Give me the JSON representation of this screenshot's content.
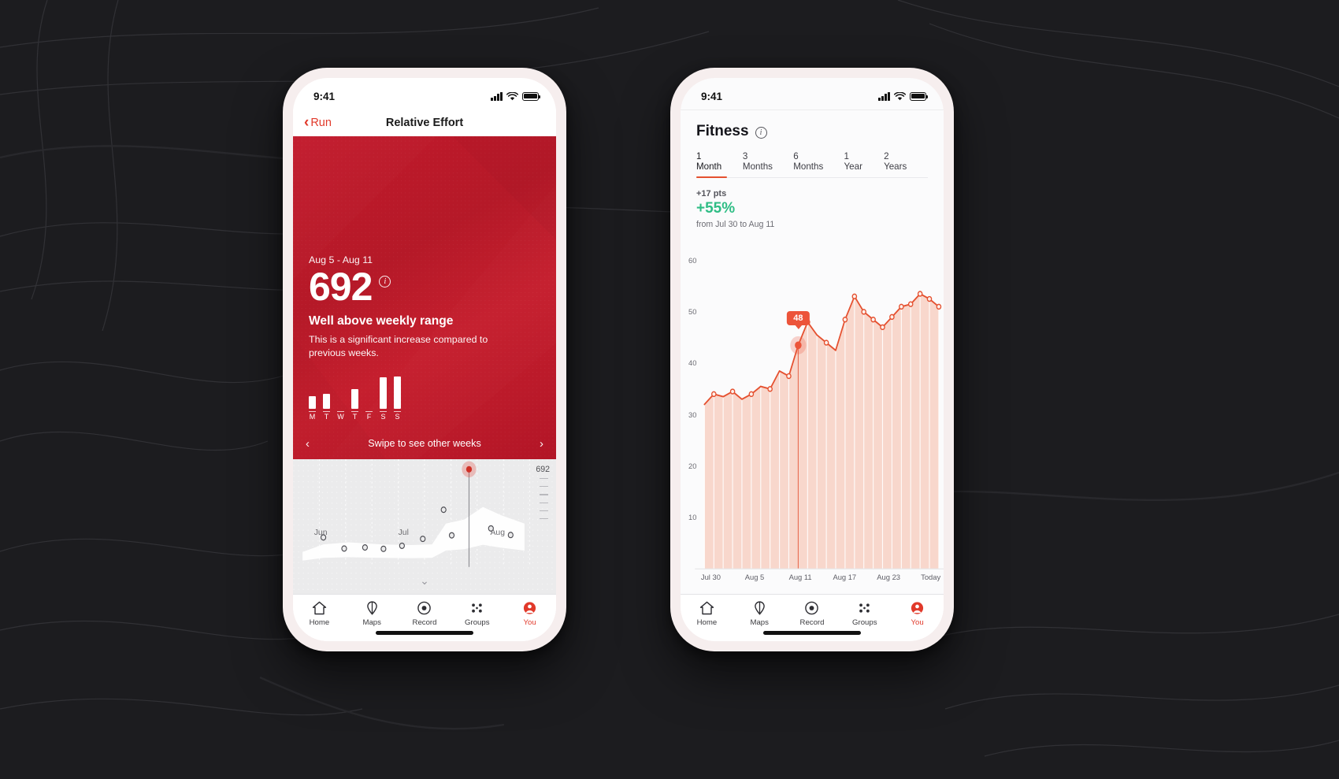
{
  "background": {
    "color": "#1c1c1f"
  },
  "phone_left": {
    "status": {
      "time": "9:41",
      "signal_icon": "cellular-bars-icon",
      "wifi_icon": "wifi-icon",
      "battery_icon": "battery-icon"
    },
    "nav": {
      "back_label": "Run",
      "back_icon": "chevron-left-icon",
      "title": "Relative Effort"
    },
    "hero": {
      "date_range": "Aug 5 - Aug 11",
      "score": "692",
      "info_icon": "info-icon",
      "headline": "Well above weekly range",
      "subtext": "This is a significant increase compared to previous weeks.",
      "swipe_hint": "Swipe to see other weeks",
      "prev_icon": "chevron-left-icon",
      "next_icon": "chevron-right-icon",
      "accent": "#c2192b"
    },
    "week_chart": {
      "type": "bar",
      "categories": [
        "M",
        "T",
        "W",
        "T",
        "F",
        "S",
        "S"
      ],
      "values": [
        22,
        26,
        0,
        35,
        0,
        55,
        58
      ],
      "ylim": [
        0,
        60
      ],
      "title": "Daily relative effort",
      "xlabel": "",
      "ylabel": ""
    },
    "history_chart": {
      "type": "line",
      "title": "Relative Effort history",
      "xlabel": "",
      "ylabel": "",
      "x_ticks": [
        "Jun",
        "Jul",
        "Aug"
      ],
      "x_tick_pos": [
        0.05,
        0.37,
        0.72
      ],
      "selected_label": "692",
      "ylim": [
        0,
        700
      ],
      "points": [
        {
          "x": 0.09,
          "y": 200
        },
        {
          "x": 0.18,
          "y": 120
        },
        {
          "x": 0.27,
          "y": 128
        },
        {
          "x": 0.35,
          "y": 118
        },
        {
          "x": 0.43,
          "y": 140
        },
        {
          "x": 0.52,
          "y": 190
        },
        {
          "x": 0.61,
          "y": 400
        },
        {
          "x": 0.645,
          "y": 215
        },
        {
          "x": 0.72,
          "y": 692
        },
        {
          "x": 0.815,
          "y": 265
        },
        {
          "x": 0.9,
          "y": 218
        }
      ],
      "selected_index": 8
    },
    "tabbar": {
      "items": [
        {
          "label": "Home",
          "icon": "home-icon",
          "active": false
        },
        {
          "label": "Maps",
          "icon": "map-pin-icon",
          "active": false
        },
        {
          "label": "Record",
          "icon": "record-circle-icon",
          "active": false
        },
        {
          "label": "Groups",
          "icon": "groups-dots-icon",
          "active": false
        },
        {
          "label": "You",
          "icon": "you-avatar-icon",
          "active": true
        }
      ],
      "active_color": "#e1392a"
    }
  },
  "phone_right": {
    "status": {
      "time": "9:41",
      "signal_icon": "cellular-bars-icon",
      "wifi_icon": "wifi-icon",
      "battery_icon": "battery-icon"
    },
    "header": {
      "title": "Fitness",
      "info_icon": "info-icon"
    },
    "tabs": [
      {
        "label": "1 Month",
        "active": true
      },
      {
        "label": "3 Months",
        "active": false
      },
      {
        "label": "6 Months",
        "active": false
      },
      {
        "label": "1 Year",
        "active": false
      },
      {
        "label": "2 Years",
        "active": false
      }
    ],
    "tabs_accent": "#e5502f",
    "stats": {
      "points": "+17 pts",
      "percent": "+55%",
      "percent_color": "#2fbd85",
      "from": "from Jul 30 to Aug 11"
    },
    "chart_data": {
      "type": "area",
      "title": "Fitness",
      "xlabel": "",
      "ylabel": "",
      "ylim": [
        0,
        62
      ],
      "y_ticks": [
        10,
        20,
        30,
        40,
        50,
        60
      ],
      "x_ticks": [
        "Jul 30",
        "Aug 5",
        "Aug 11",
        "Aug 17",
        "Aug 23",
        "Today"
      ],
      "x_tick_pos": [
        0.02,
        0.21,
        0.4,
        0.59,
        0.78,
        0.97
      ],
      "grid": false,
      "legend": "none",
      "line_color": "#e5502f",
      "fill_color": "#f9d8cd",
      "highlight": {
        "index": 10,
        "value": "48",
        "label": "48"
      },
      "values": [
        32,
        34,
        33.5,
        34.5,
        33,
        34,
        35.5,
        35,
        38.5,
        37.5,
        43.5,
        48,
        45.5,
        44,
        42.5,
        48.5,
        53,
        50,
        48.5,
        47,
        49,
        51,
        51.5,
        53.5,
        52.5,
        51
      ]
    },
    "tabbar": {
      "items": [
        {
          "label": "Home",
          "icon": "home-icon",
          "active": false
        },
        {
          "label": "Maps",
          "icon": "map-pin-icon",
          "active": false
        },
        {
          "label": "Record",
          "icon": "record-circle-icon",
          "active": false
        },
        {
          "label": "Groups",
          "icon": "groups-dots-icon",
          "active": false
        },
        {
          "label": "You",
          "icon": "you-avatar-icon",
          "active": true
        }
      ],
      "active_color": "#e1392a"
    }
  }
}
